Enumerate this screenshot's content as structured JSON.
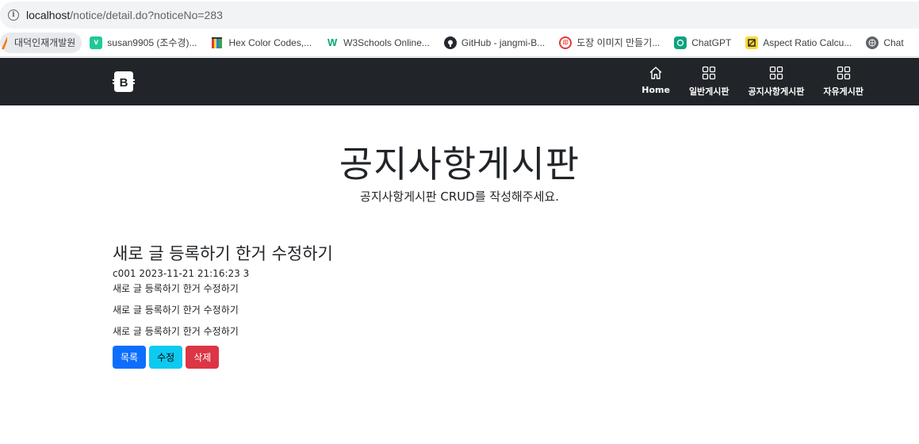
{
  "browser": {
    "url_host": "localhost",
    "url_path": "/notice/detail.do?noticeNo=283"
  },
  "bookmarks": [
    {
      "label": "대덕인재개발원",
      "icon": "flame-icon",
      "color": "#f57c00"
    },
    {
      "label": "susan9905 (조수경)...",
      "icon": "v-icon",
      "color": "#20c997"
    },
    {
      "label": "Hex Color Codes,...",
      "icon": "palette-book-icon",
      "color": "#e53935"
    },
    {
      "label": "W3Schools Online...",
      "icon": "w3-icon",
      "color": "#04aa6d"
    },
    {
      "label": "GitHub - jangmi-B...",
      "icon": "github-icon",
      "color": "#24292f"
    },
    {
      "label": "도장 이미지 만들기...",
      "icon": "stamp-icon",
      "color": "#e53935"
    },
    {
      "label": "ChatGPT",
      "icon": "chatgpt-icon",
      "color": "#10a37f"
    },
    {
      "label": "Aspect Ratio Calcu...",
      "icon": "aspect-icon",
      "color": "#fdd835"
    },
    {
      "label": "Chat",
      "icon": "globe-icon",
      "color": "#5f6368"
    }
  ],
  "navbar": {
    "brand_icon": "bootstrap-icon",
    "items": [
      {
        "label": "Home",
        "icon": "home-icon"
      },
      {
        "label": "일반게시판",
        "icon": "grid-icon"
      },
      {
        "label": "공지사항게시판",
        "icon": "grid-icon"
      },
      {
        "label": "자유게시판",
        "icon": "grid-icon"
      }
    ]
  },
  "hero": {
    "title": "공지사항게시판",
    "subtitle": "공지사항게시판 CRUD를 작성해주세요."
  },
  "article": {
    "title": "새로 글 등록하기 한거 수정하기",
    "meta": "c001 2023-11-21 21:16:23 3",
    "paragraphs": [
      "새로 글 등록하기 한거 수정하기",
      "새로 글 등록하기 한거 수정하기",
      "새로 글 등록하기 한거 수정하기"
    ]
  },
  "buttons": {
    "list": "목록",
    "edit": "수정",
    "delete": "삭제"
  }
}
